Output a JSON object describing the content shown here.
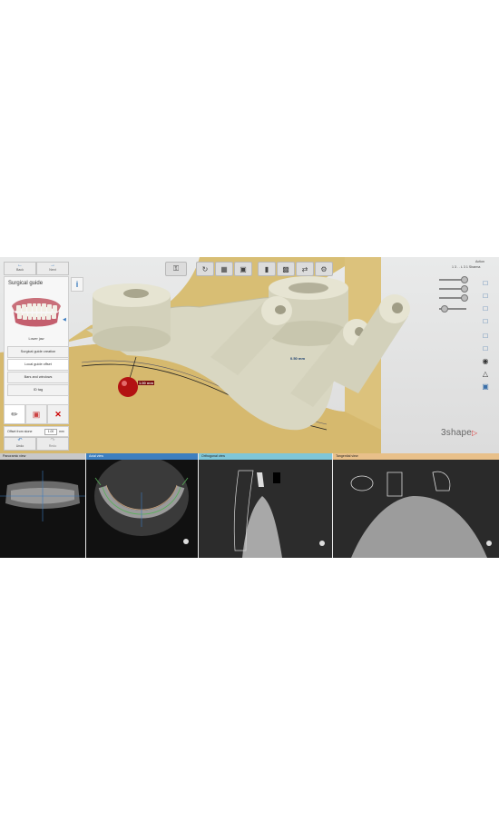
{
  "nav": {
    "back_label": "Back",
    "next_label": "Next"
  },
  "panel": {
    "title": "Surgical guide",
    "jaw_label": "Lower jaw",
    "workflow_items": [
      "Surgical guide creation",
      "Local guide offset",
      "Bars and windows",
      "ID tag"
    ],
    "offset_label": "Offset from stone",
    "offset_value": "1.00",
    "offset_unit": "mm",
    "undo_label": "Undo",
    "redo_label": "Redo"
  },
  "right_panel": {
    "action_label": "Action",
    "view_label": "1 3 . . L 3 1 Sharma"
  },
  "measurements": {
    "ball_label": "1.00 mm",
    "guide_label": "0.50 mm"
  },
  "brand": {
    "logo_text": "3shape"
  },
  "views": {
    "panoramic": "Panoramic view",
    "axial": "Axial view",
    "orthogonal": "Orthogonal view",
    "tangential": "Tangential view"
  },
  "colors": {
    "accent": "#3b7bbf",
    "view_header": "#c8c8c8",
    "axial_header": "#3e7fbf",
    "orthogonal_header": "#7fc6d8",
    "tangential_header": "#e8c08a",
    "guide": "#d9d7c2",
    "bone": "#dcc27c",
    "sphere": "#b31212"
  },
  "icons": [
    "tooth-icon",
    "rotate-icon",
    "view-icon",
    "cube-icon",
    "implant-icon",
    "scan-icon",
    "sync-icon",
    "info-icon",
    "brush-icon",
    "eraser-icon",
    "close-icon"
  ]
}
